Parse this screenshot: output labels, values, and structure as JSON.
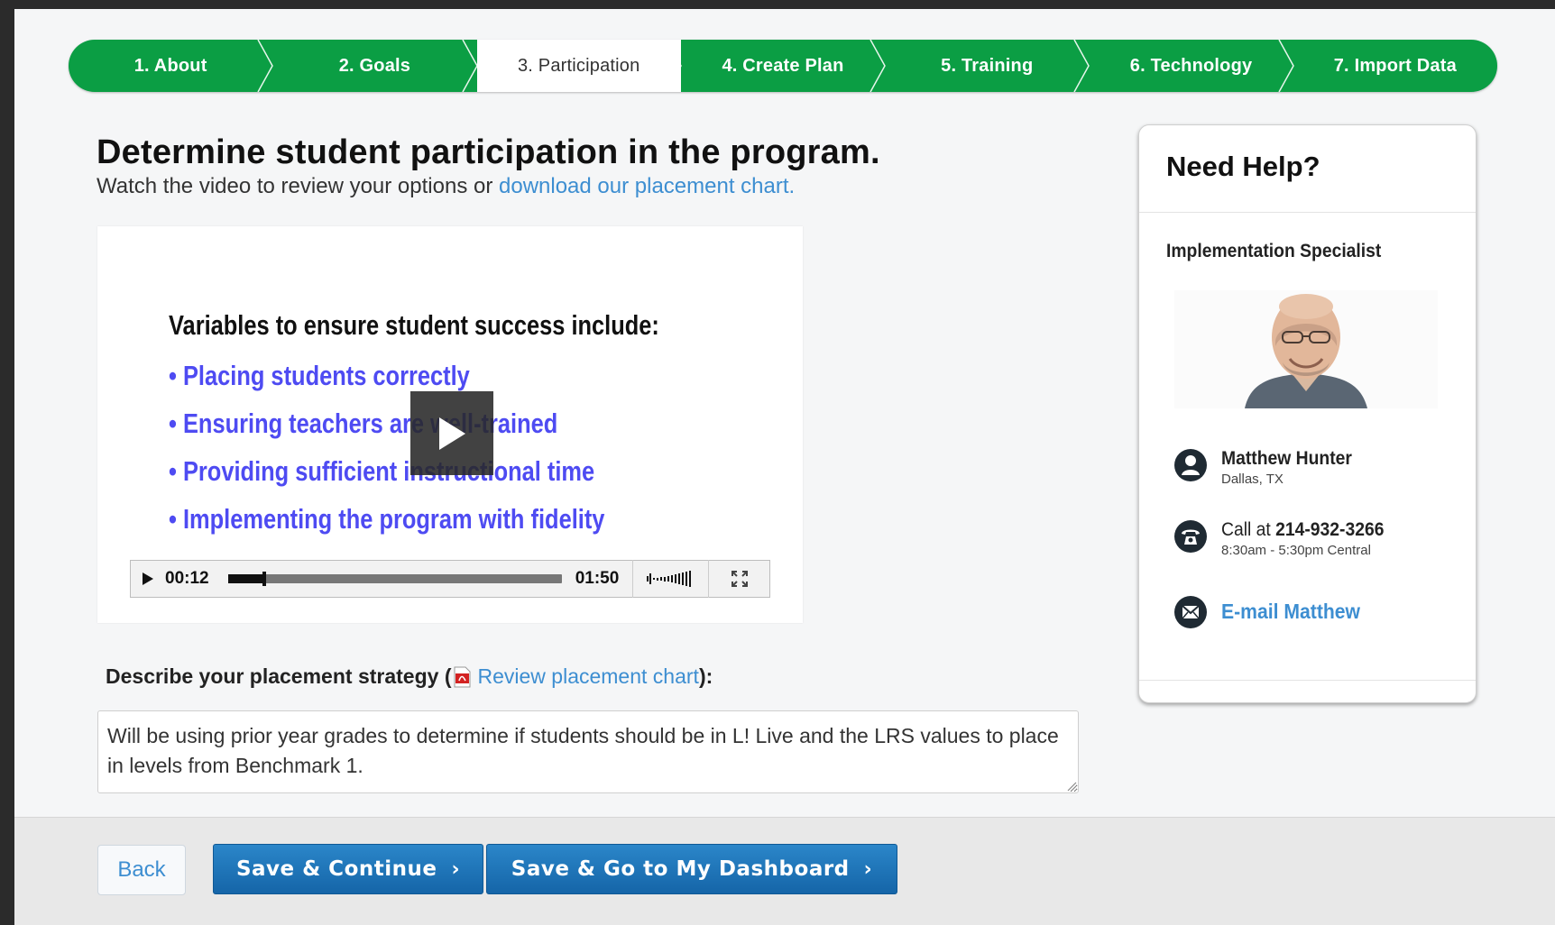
{
  "steps": [
    {
      "label": "1. About",
      "active": false
    },
    {
      "label": "2. Goals",
      "active": false
    },
    {
      "label": "3. Participation",
      "active": true
    },
    {
      "label": "4. Create Plan",
      "active": false
    },
    {
      "label": "5. Training",
      "active": false
    },
    {
      "label": "6. Technology",
      "active": false
    },
    {
      "label": "7. Import Data",
      "active": false
    }
  ],
  "main": {
    "title": "Determine student participation in the program.",
    "subtitle_prefix": "Watch the video to review your options or ",
    "subtitle_link": "download our placement chart."
  },
  "video": {
    "slide_title": "Variables to ensure student success include:",
    "bullets": [
      "• Placing students correctly",
      "• Ensuring teachers are well-trained",
      "• Providing sufficient instructional time",
      "• Implementing the program with fidelity"
    ],
    "current_time": "00:12",
    "total_time": "01:50",
    "progress_fraction": 0.109
  },
  "strategy": {
    "label_prefix": "Describe your placement strategy (",
    "link": "Review placement chart",
    "label_suffix": "):",
    "value": "Will be using prior year grades to determine if students should be in L! Live and the LRS values to place in levels from Benchmark 1."
  },
  "help": {
    "title": "Need Help?",
    "role": "Implementation Specialist",
    "name": "Matthew Hunter",
    "location": "Dallas, TX",
    "call_prefix": "Call at ",
    "phone": "214-932-3266",
    "hours": "8:30am - 5:30pm Central",
    "email_label": "E-mail Matthew"
  },
  "footer": {
    "back": "Back",
    "save_continue": "Save & Continue",
    "save_dashboard": "Save & Go to My Dashboard"
  },
  "colors": {
    "step_green": "#0b9e44",
    "link_blue": "#3d8ed1",
    "bullet_purple": "#4e4bf2",
    "button_blue": "#1c74b9"
  },
  "icons": [
    "play-icon",
    "volume-icon",
    "fullscreen-icon",
    "pdf-icon",
    "person-icon",
    "phone-icon",
    "email-icon",
    "chevron-right-icon",
    "resize-grip-icon"
  ]
}
